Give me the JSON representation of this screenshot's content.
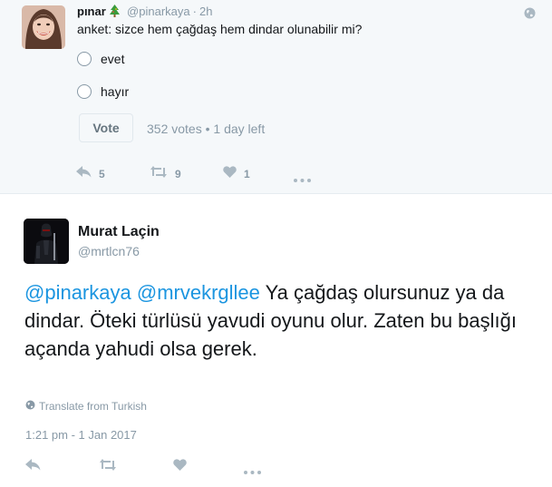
{
  "top_tweet": {
    "display_name": "pınar",
    "handle": "@pinarkaya",
    "separator": "·",
    "time": "2h",
    "question": "anket: sizce hem çağdaş hem dindar olunabilir mi?",
    "poll_options": [
      "evet",
      "hayır"
    ],
    "vote_button_label": "Vote",
    "vote_info": "352 votes • 1 day left",
    "actions": {
      "reply_count": "5",
      "retweet_count": "9",
      "like_count": "1"
    }
  },
  "reply_tweet": {
    "display_name": "Murat Laçin",
    "handle": "@mrtlcn76",
    "mention_1": "@pinarkaya",
    "mention_2": "@mrvekrgllee",
    "body": " Ya çağdaş olursunuz ya da dindar. Öteki türlüsü yavudi oyunu olur. Zaten bu başlığı açanda yahudi olsa gerek.",
    "translate_label": "Translate from Turkish",
    "timestamp": "1:21 pm - 1 Jan 2017"
  },
  "colors": {
    "link": "#1b95e0",
    "secondary_text": "#8899a6",
    "icon": "#aab8c2",
    "tweet_bg": "#f5f8fa"
  },
  "icons": [
    "globe-icon",
    "reply-icon",
    "retweet-icon",
    "like-icon",
    "more-icon",
    "christmas-tree-emoji"
  ]
}
